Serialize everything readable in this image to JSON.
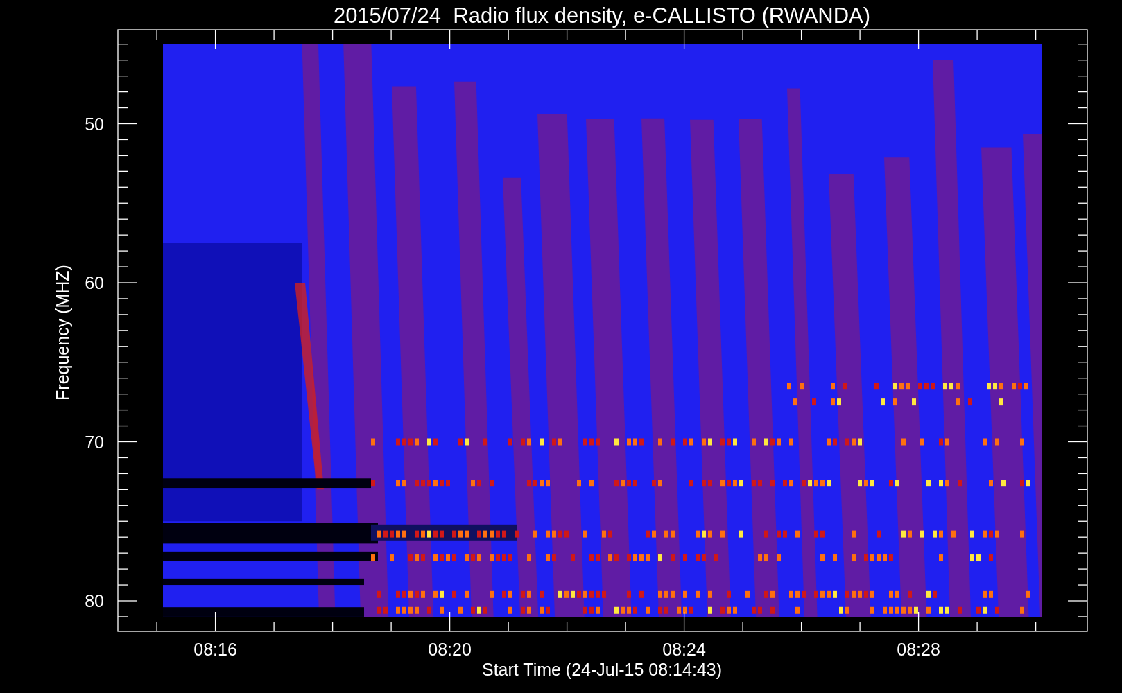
{
  "title": "2015/07/24  Radio flux density, e-CALLISTO (RWANDA)",
  "y_axis": {
    "label": "Frequency (MHZ)",
    "ticks": [
      "50",
      "60",
      "70",
      "80"
    ]
  },
  "x_axis": {
    "label": "Start Time (24-Jul-15 08:14:43)",
    "ticks": [
      "08:16",
      "08:20",
      "08:24",
      "08:28"
    ]
  }
}
